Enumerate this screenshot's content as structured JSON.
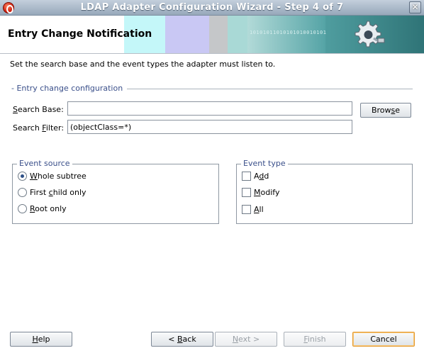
{
  "window": {
    "title": "LDAP Adapter Configuration Wizard - Step 4 of 7",
    "close_glyph": "✕"
  },
  "header": {
    "heading": "Entry Change Notification",
    "binary_text": "10101011010101010010101"
  },
  "instruction": "Set the search base and the event types the adapter must listen to.",
  "entry_config": {
    "section_title": "- Entry change configuration",
    "search_base": {
      "label_prefix": "",
      "label_mnemonic": "S",
      "label_rest": "earch Base:",
      "value": ""
    },
    "search_filter": {
      "label_prefix": "Search ",
      "label_mnemonic": "F",
      "label_rest": "ilter:",
      "value": "(objectClass=*)"
    },
    "browse_button": {
      "prefix": "Brow",
      "mnemonic": "s",
      "rest": "e"
    }
  },
  "event_source": {
    "legend": "Event source",
    "options": [
      {
        "prefix": "",
        "mnemonic": "W",
        "rest": "hole subtree",
        "checked": true
      },
      {
        "prefix": "First ",
        "mnemonic": "c",
        "rest": "hild only",
        "checked": false
      },
      {
        "prefix": "",
        "mnemonic": "R",
        "rest": "oot only",
        "checked": false
      }
    ]
  },
  "event_type": {
    "legend": "Event type",
    "options": [
      {
        "prefix": "A",
        "mnemonic": "d",
        "rest": "d",
        "checked": false
      },
      {
        "prefix": "",
        "mnemonic": "M",
        "rest": "odify",
        "checked": false
      },
      {
        "prefix": "",
        "mnemonic": "A",
        "rest": "ll",
        "checked": false
      }
    ]
  },
  "footer": {
    "help": {
      "prefix": "",
      "mnemonic": "H",
      "rest": "elp"
    },
    "back": {
      "prefix": "< ",
      "mnemonic": "B",
      "rest": "ack"
    },
    "next": {
      "prefix": "",
      "mnemonic": "N",
      "rest": "ext >"
    },
    "finish": {
      "prefix": "",
      "mnemonic": "F",
      "rest": "inish"
    },
    "cancel": {
      "prefix": "",
      "mnemonic": "",
      "rest": "Cancel"
    }
  },
  "colors": {
    "title_bar": "#97a8ba",
    "section_text": "#3a4f8a",
    "default_button_border": "#e59a2f",
    "banner_teal": "#2f7477"
  },
  "icons": [
    "oracle-app-icon",
    "close-icon",
    "gear-plug-icon"
  ]
}
